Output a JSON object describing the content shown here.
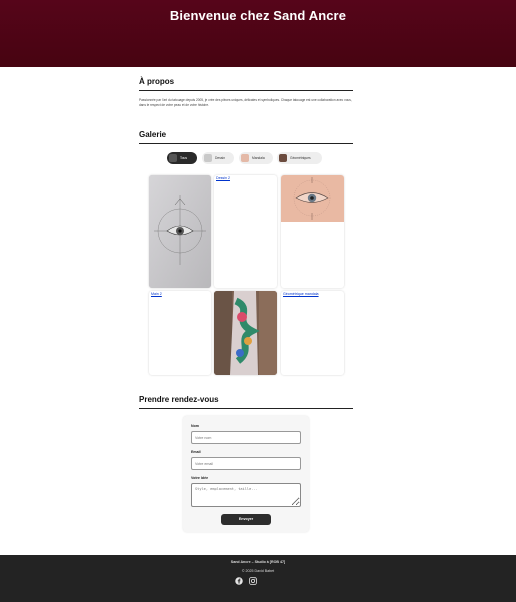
{
  "header": {
    "title": "Bienvenue chez Sand Ancre"
  },
  "about": {
    "heading": "À propos",
    "text": "Passionnée par l'art du tatouage depuis 2005, je crée des pièces uniques, délicates et symboliques. Chaque tatouage est une collaboration avec vous, dans le respect de votre peau et de votre histoire."
  },
  "gallery": {
    "heading": "Galerie",
    "filters": [
      {
        "label": "Tous",
        "active": true
      },
      {
        "label": "Dessin",
        "active": false
      },
      {
        "label": "Mandala",
        "active": false
      },
      {
        "label": "Géométriques",
        "active": false
      }
    ],
    "broken_images": {
      "dessin": "Dessin 2",
      "main": "Main 2",
      "geo": "Géométrique mandala"
    }
  },
  "appointment": {
    "heading": "Prendre rendez-vous",
    "name_label": "Nom",
    "name_placeholder": "Votre nom",
    "email_label": "Email",
    "email_placeholder": "Votre email",
    "idea_label": "Votre Idée",
    "idea_placeholder": "Style, emplacement, taille...",
    "submit_label": "Envoyer"
  },
  "footer": {
    "address": "Sand Ancre – Studio à [ROB 47]",
    "copyright": "© 2025 David Babet",
    "social": [
      "facebook-icon",
      "instagram-icon"
    ]
  },
  "colors": {
    "header_bg": "#4a0410",
    "footer_bg": "#232323",
    "button_bg": "#2d2d2d"
  }
}
